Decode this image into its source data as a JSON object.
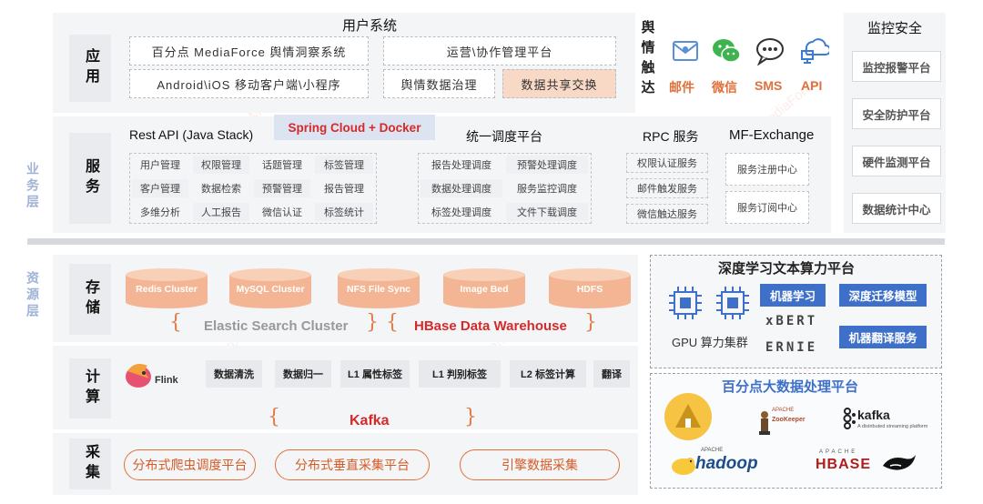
{
  "left_titles": {
    "business": "业务层",
    "resource": "资源层"
  },
  "rows": {
    "app": "应用",
    "service": "服务",
    "storage": "存储",
    "compute": "计算",
    "collect": "采集"
  },
  "app": {
    "title": "用户系统",
    "boxes": [
      "百分点 MediaForce 舆情洞察系统",
      "运营\\协作管理平台",
      "Android\\iOS 移动客户端\\小程序",
      "舆情数据治理",
      "数据共享交换"
    ],
    "reach_label": "舆情触达",
    "reach": [
      {
        "icon": "email-icon",
        "label": "邮件"
      },
      {
        "icon": "wechat-icon",
        "label": "微信"
      },
      {
        "icon": "sms-icon",
        "label": "SMS"
      },
      {
        "icon": "api-icon",
        "label": "API"
      }
    ]
  },
  "service": {
    "spring": "Spring Cloud + Docker",
    "rest_title": "Rest API (Java Stack)",
    "rest_items": [
      "用户管理",
      "权限管理",
      "话题管理",
      "标签管理",
      "客户管理",
      "数据检索",
      "预警管理",
      "报告管理",
      "多维分析",
      "人工报告",
      "微信认证",
      "标签统计"
    ],
    "schedule_title": "统一调度平台",
    "schedule_items": [
      "报告处理调度",
      "预警处理调度",
      "数据处理调度",
      "服务监控调度",
      "标签处理调度",
      "文件下载调度"
    ],
    "rpc_title": "RPC 服务",
    "rpc_items": [
      "权限认证服务",
      "邮件触发服务",
      "微信触达服务"
    ],
    "mfx_title": "MF-Exchange",
    "mfx_items": [
      "服务注册中心",
      "服务订阅中心"
    ]
  },
  "monitor": {
    "title": "监控安全",
    "items": [
      "监控报警平台",
      "安全防护平台",
      "硬件监测平台",
      "数据统计中心"
    ]
  },
  "storage": {
    "dbs": [
      "Redis Cluster",
      "MySQL Cluster",
      "NFS File Sync",
      "Image Bed",
      "HDFS"
    ],
    "es": "Elastic Search Cluster",
    "hbase": "HBase Data Warehouse"
  },
  "compute": {
    "flink": "Flink",
    "ops": [
      "数据清洗",
      "数据归一",
      "L1 属性标签",
      "L1 判别标签",
      "L2 标签计算",
      "翻译"
    ],
    "kafka": "Kafka"
  },
  "collect": {
    "items": [
      "分布式爬虫调度平台",
      "分布式垂直采集平台",
      "引擎数据采集"
    ]
  },
  "dl": {
    "title": "深度学习文本算力平台",
    "gpu": "GPU 算力集群",
    "ml": "机器学习",
    "transfer": "深度迁移模型",
    "bert": "xBERT",
    "ernie": "ERNIE",
    "mt": "机器翻译服务"
  },
  "bigdata": {
    "title": "百分点大数据处理平台",
    "zk_small": "APACHE",
    "zk": "ZooKeeper",
    "kafka": "kafka",
    "kafka_sub": "A distributed streaming platform",
    "hadoop_small": "APACHE",
    "hadoop": "hadoop",
    "hbase_small": "APACHE",
    "hbase": "HBASE"
  },
  "watermark": "Baifendian MediaForce",
  "colors": {
    "accent_orange": "#e0703b",
    "red": "#d62a2a",
    "blue": "#3e70c9",
    "side_blue": "#9eb3d6"
  }
}
